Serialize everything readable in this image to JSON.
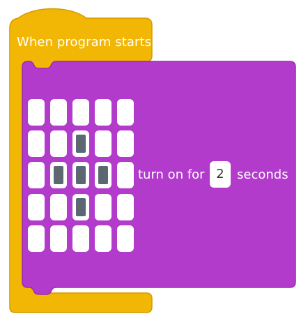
{
  "colors": {
    "event_block": "#f2b705",
    "event_block_border": "#d49b00",
    "action_block": "#b33bcb",
    "action_block_border": "#9b2bb3",
    "led_off": "#ffffff",
    "led_on": "#5b6872"
  },
  "event_block": {
    "label": "When program starts"
  },
  "action_block": {
    "text_before": "turn on for",
    "duration_value": "2",
    "text_after": "seconds",
    "matrix": {
      "rows": 5,
      "cols": 5,
      "on": [
        [
          0,
          0,
          0,
          0,
          0
        ],
        [
          0,
          0,
          1,
          0,
          0
        ],
        [
          0,
          1,
          1,
          1,
          0
        ],
        [
          0,
          0,
          1,
          0,
          0
        ],
        [
          0,
          0,
          0,
          0,
          0
        ]
      ]
    }
  }
}
